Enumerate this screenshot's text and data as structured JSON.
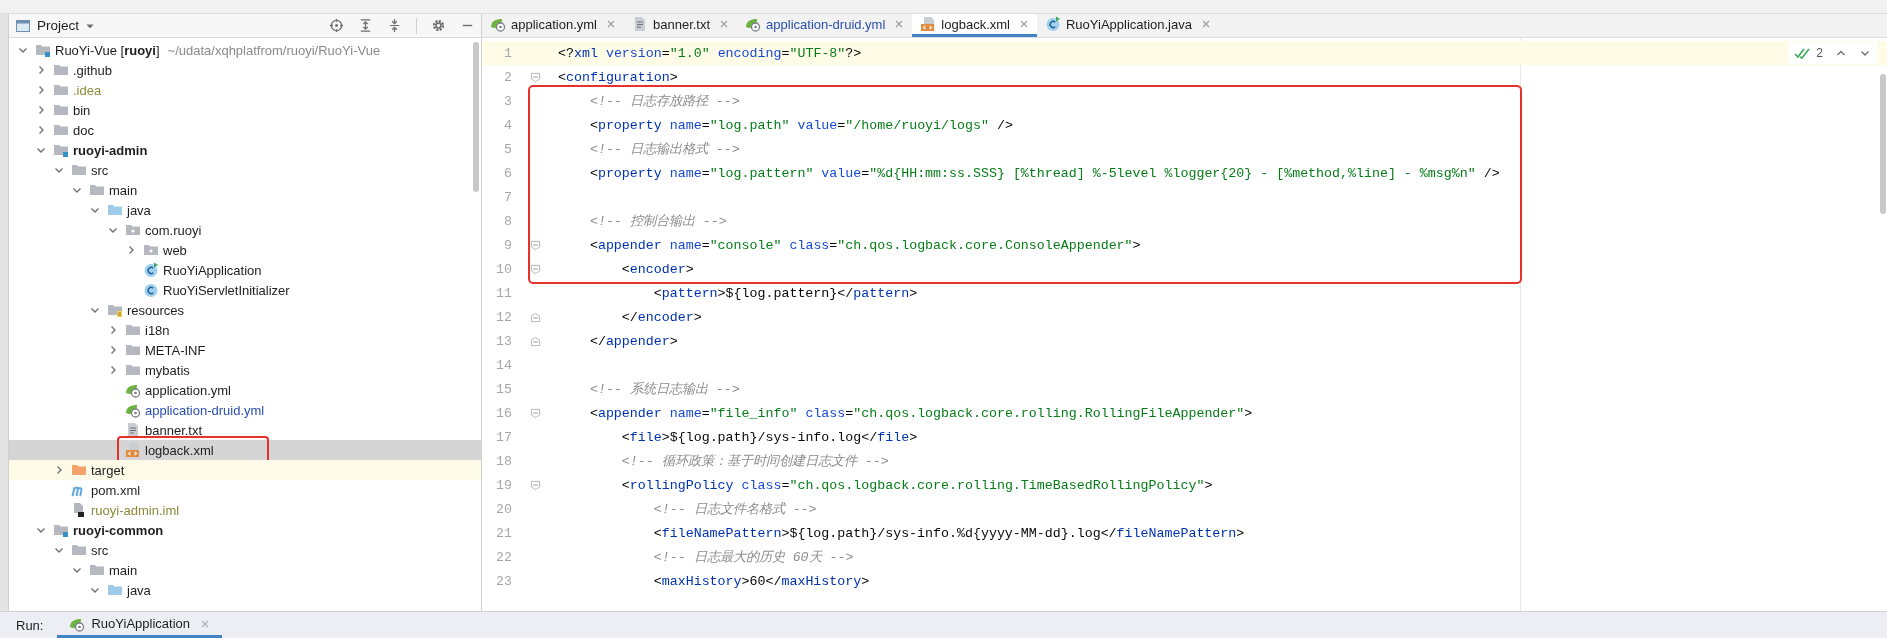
{
  "project_panel": {
    "title": "Project",
    "tree": [
      {
        "name": "RuoYi-Vue [**ruoyi**]",
        "path": "~/udata/xqhplatfrom/ruoyi/RuoYi-Vue",
        "kind": "module",
        "bold": false,
        "expanded": true,
        "selected": false,
        "boxed": false,
        "children": [
          {
            "name": ".github",
            "kind": "folder",
            "bold": false,
            "expanded": false,
            "selected": false,
            "boxed": false
          },
          {
            "name": ".idea",
            "kind": "folder",
            "color": "#8a8a3a",
            "bold": false,
            "expanded": false,
            "selected": false,
            "boxed": false
          },
          {
            "name": "bin",
            "kind": "folder",
            "bold": false,
            "expanded": false,
            "selected": false,
            "boxed": false
          },
          {
            "name": "doc",
            "kind": "folder",
            "bold": false,
            "expanded": false,
            "selected": false,
            "boxed": false
          },
          {
            "name": "ruoyi-admin",
            "kind": "module",
            "bold": true,
            "expanded": true,
            "selected": false,
            "boxed": false,
            "children": [
              {
                "name": "src",
                "kind": "folder",
                "bold": false,
                "expanded": true,
                "selected": false,
                "boxed": false,
                "children": [
                  {
                    "name": "main",
                    "kind": "folder",
                    "bold": false,
                    "expanded": true,
                    "selected": false,
                    "boxed": false,
                    "children": [
                      {
                        "name": "java",
                        "kind": "source-folder",
                        "bold": false,
                        "expanded": true,
                        "selected": false,
                        "boxed": false,
                        "children": [
                          {
                            "name": "com.ruoyi",
                            "kind": "package",
                            "bold": false,
                            "expanded": true,
                            "selected": false,
                            "boxed": false,
                            "children": [
                              {
                                "name": "web",
                                "kind": "package",
                                "bold": false,
                                "expanded": false,
                                "selected": false,
                                "boxed": false
                              },
                              {
                                "name": "RuoYiApplication",
                                "kind": "class-run",
                                "bold": false,
                                "selected": false,
                                "boxed": false
                              },
                              {
                                "name": "RuoYiServletInitializer",
                                "kind": "class",
                                "bold": false,
                                "selected": false,
                                "boxed": false
                              }
                            ]
                          }
                        ]
                      },
                      {
                        "name": "resources",
                        "kind": "resources",
                        "bold": false,
                        "expanded": true,
                        "selected": false,
                        "boxed": false,
                        "children": [
                          {
                            "name": "i18n",
                            "kind": "folder",
                            "bold": false,
                            "expanded": false,
                            "selected": false,
                            "boxed": false
                          },
                          {
                            "name": "META-INF",
                            "kind": "folder",
                            "bold": false,
                            "expanded": false,
                            "selected": false,
                            "boxed": false
                          },
                          {
                            "name": "mybatis",
                            "kind": "folder",
                            "bold": false,
                            "expanded": false,
                            "selected": false,
                            "boxed": false
                          },
                          {
                            "name": "application.yml",
                            "kind": "spring-yml",
                            "bold": false,
                            "selected": false,
                            "boxed": false
                          },
                          {
                            "name": "application-druid.yml",
                            "kind": "spring-yml",
                            "color": "#2a4fb0",
                            "bold": false,
                            "selected": false,
                            "boxed": false
                          },
                          {
                            "name": "banner.txt",
                            "kind": "text-file",
                            "bold": false,
                            "selected": false,
                            "boxed": false
                          },
                          {
                            "name": "logback.xml",
                            "kind": "xml-file",
                            "bold": false,
                            "selected": true,
                            "boxed": true
                          }
                        ]
                      }
                    ]
                  }
                ]
              },
              {
                "name": "target",
                "kind": "excluded-folder",
                "bold": false,
                "expanded": false,
                "selected": false,
                "boxed": false
              },
              {
                "name": "pom.xml",
                "kind": "maven",
                "bold": false,
                "selected": false,
                "boxed": false
              },
              {
                "name": "ruoyi-admin.iml",
                "kind": "iml",
                "color": "#8a8a3a",
                "bold": false,
                "selected": false,
                "boxed": false
              }
            ]
          },
          {
            "name": "ruoyi-common",
            "kind": "module",
            "bold": true,
            "expanded": true,
            "selected": false,
            "boxed": false,
            "children": [
              {
                "name": "src",
                "kind": "folder",
                "bold": false,
                "expanded": true,
                "selected": false,
                "boxed": false,
                "children": [
                  {
                    "name": "main",
                    "kind": "folder",
                    "bold": false,
                    "expanded": true,
                    "selected": false,
                    "boxed": false,
                    "children": [
                      {
                        "name": "java",
                        "kind": "source-folder",
                        "bold": false,
                        "expanded": true,
                        "selected": false,
                        "boxed": false
                      }
                    ]
                  }
                ]
              }
            ]
          }
        ]
      }
    ]
  },
  "editor_tabs": [
    {
      "label": "application.yml",
      "kind": "spring-yml",
      "selected": false
    },
    {
      "label": "banner.txt",
      "kind": "text-file",
      "selected": false
    },
    {
      "label": "application-druid.yml",
      "kind": "spring-yml",
      "color": "#2a4fb0",
      "selected": false
    },
    {
      "label": "logback.xml",
      "kind": "xml-file",
      "selected": true
    },
    {
      "label": "RuoYiApplication.java",
      "kind": "class-run",
      "selected": false
    }
  ],
  "editor": {
    "inspection_count": "2",
    "blocks": [
      {
        "boxed": false,
        "lines": [
          {
            "number": "1",
            "kind": "plain",
            "current": true,
            "tokens": [
              {
                "kind": "punct",
                "text": "<?"
              },
              {
                "kind": "tag",
                "text": "xml"
              },
              {
                "kind": "attr",
                "text": " version"
              },
              {
                "kind": "punct",
                "text": "="
              },
              {
                "kind": "value",
                "text": "\"1.0\""
              },
              {
                "kind": "attr",
                "text": " encoding"
              },
              {
                "kind": "punct",
                "text": "="
              },
              {
                "kind": "value",
                "text": "\"UTF-8\""
              },
              {
                "kind": "punct",
                "text": "?>"
              }
            ]
          },
          {
            "number": "2",
            "kind": "opening",
            "current": false,
            "tokens": [
              {
                "kind": "punct",
                "text": "<"
              },
              {
                "kind": "tag",
                "text": "configuration"
              },
              {
                "kind": "punct",
                "text": ">"
              }
            ]
          }
        ]
      },
      {
        "boxed": true,
        "lines": [
          {
            "number": "3",
            "kind": "plain",
            "current": false,
            "tokens": [
              {
                "kind": "comment",
                "text": "    <!-- 日志存放路径 -->"
              }
            ]
          },
          {
            "number": "4",
            "kind": "plain",
            "current": false,
            "tokens": [
              {
                "kind": "punct",
                "text": "    <"
              },
              {
                "kind": "tag",
                "text": "property"
              },
              {
                "kind": "attr",
                "text": " name"
              },
              {
                "kind": "punct",
                "text": "="
              },
              {
                "kind": "value",
                "text": "\"log.path\""
              },
              {
                "kind": "attr",
                "text": " value"
              },
              {
                "kind": "punct",
                "text": "="
              },
              {
                "kind": "value",
                "text": "\"/home/ruoyi/logs\""
              },
              {
                "kind": "punct",
                "text": " />"
              }
            ]
          },
          {
            "number": "5",
            "kind": "plain",
            "current": false,
            "tokens": [
              {
                "kind": "comment",
                "text": "    <!-- 日志输出格式 -->"
              }
            ]
          },
          {
            "number": "6",
            "kind": "plain",
            "current": false,
            "tokens": [
              {
                "kind": "punct",
                "text": "    <"
              },
              {
                "kind": "tag",
                "text": "property"
              },
              {
                "kind": "attr",
                "text": " name"
              },
              {
                "kind": "punct",
                "text": "="
              },
              {
                "kind": "value",
                "text": "\"log.pattern\""
              },
              {
                "kind": "attr",
                "text": " value"
              },
              {
                "kind": "punct",
                "text": "="
              },
              {
                "kind": "value",
                "text": "\"%d{HH:mm:ss.SSS} [%thread] %-5level %logger{20} - [%method,%line] - %msg%n\""
              },
              {
                "kind": "punct",
                "text": " />"
              }
            ]
          },
          {
            "number": "7",
            "kind": "plain",
            "current": false
          },
          {
            "number": "8",
            "kind": "plain",
            "current": false,
            "tokens": [
              {
                "kind": "comment",
                "text": "    <!-- 控制台输出 -->"
              }
            ]
          },
          {
            "number": "9",
            "kind": "opening",
            "current": false,
            "tokens": [
              {
                "kind": "punct",
                "text": "    <"
              },
              {
                "kind": "tag",
                "text": "appender"
              },
              {
                "kind": "attr",
                "text": " name"
              },
              {
                "kind": "punct",
                "text": "="
              },
              {
                "kind": "value",
                "text": "\"console\""
              },
              {
                "kind": "attr",
                "text": " class"
              },
              {
                "kind": "punct",
                "text": "="
              },
              {
                "kind": "value",
                "text": "\"ch.qos.logback.core.ConsoleAppender\""
              },
              {
                "kind": "punct",
                "text": ">"
              }
            ]
          },
          {
            "number": "10",
            "kind": "opening",
            "current": false,
            "tokens": [
              {
                "kind": "punct",
                "text": "        <"
              },
              {
                "kind": "tag",
                "text": "encoder"
              },
              {
                "kind": "punct",
                "text": ">"
              }
            ]
          }
        ]
      },
      {
        "boxed": false,
        "lines": [
          {
            "number": "11",
            "kind": "plain",
            "current": false,
            "tokens": [
              {
                "kind": "punct",
                "text": "            <"
              },
              {
                "kind": "tag",
                "text": "pattern"
              },
              {
                "kind": "punct",
                "text": ">"
              },
              {
                "kind": "text",
                "text": "${log.pattern}"
              },
              {
                "kind": "punct",
                "text": "</"
              },
              {
                "kind": "tag",
                "text": "pattern"
              },
              {
                "kind": "punct",
                "text": ">"
              }
            ]
          },
          {
            "number": "12",
            "kind": "closing",
            "current": false,
            "tokens": [
              {
                "kind": "punct",
                "text": "        </"
              },
              {
                "kind": "tag",
                "text": "encoder"
              },
              {
                "kind": "punct",
                "text": ">"
              }
            ]
          },
          {
            "number": "13",
            "kind": "closing",
            "current": false,
            "tokens": [
              {
                "kind": "punct",
                "text": "    </"
              },
              {
                "kind": "tag",
                "text": "appender"
              },
              {
                "kind": "punct",
                "text": ">"
              }
            ]
          },
          {
            "number": "14",
            "kind": "plain",
            "current": false
          },
          {
            "number": "15",
            "kind": "plain",
            "current": false,
            "tokens": [
              {
                "kind": "comment",
                "text": "    <!-- 系统日志输出 -->"
              }
            ]
          },
          {
            "number": "16",
            "kind": "opening",
            "current": false,
            "tokens": [
              {
                "kind": "punct",
                "text": "    <"
              },
              {
                "kind": "tag",
                "text": "appender"
              },
              {
                "kind": "attr",
                "text": " name"
              },
              {
                "kind": "punct",
                "text": "="
              },
              {
                "kind": "value",
                "text": "\"file_info\""
              },
              {
                "kind": "attr",
                "text": " class"
              },
              {
                "kind": "punct",
                "text": "="
              },
              {
                "kind": "value",
                "text": "\"ch.qos.logback.core.rolling.RollingFileAppender\""
              },
              {
                "kind": "punct",
                "text": ">"
              }
            ]
          },
          {
            "number": "17",
            "kind": "plain",
            "current": false,
            "tokens": [
              {
                "kind": "punct",
                "text": "        <"
              },
              {
                "kind": "tag",
                "text": "file"
              },
              {
                "kind": "punct",
                "text": ">"
              },
              {
                "kind": "text",
                "text": "${log.path}/sys-info.log"
              },
              {
                "kind": "punct",
                "text": "</"
              },
              {
                "kind": "tag",
                "text": "file"
              },
              {
                "kind": "punct",
                "text": ">"
              }
            ]
          },
          {
            "number": "18",
            "kind": "plain",
            "current": false,
            "tokens": [
              {
                "kind": "comment",
                "text": "        <!-- 循环政策：基于时间创建日志文件 -->"
              }
            ]
          },
          {
            "number": "19",
            "kind": "opening",
            "current": false,
            "tokens": [
              {
                "kind": "punct",
                "text": "        <"
              },
              {
                "kind": "tag",
                "text": "rollingPolicy"
              },
              {
                "kind": "attr",
                "text": " class"
              },
              {
                "kind": "punct",
                "text": "="
              },
              {
                "kind": "value",
                "text": "\"ch.qos.logback.core.rolling.TimeBasedRollingPolicy\""
              },
              {
                "kind": "punct",
                "text": ">"
              }
            ]
          },
          {
            "number": "20",
            "kind": "plain",
            "current": false,
            "tokens": [
              {
                "kind": "comment",
                "text": "            <!-- 日志文件名格式 -->"
              }
            ]
          },
          {
            "number": "21",
            "kind": "plain",
            "current": false,
            "tokens": [
              {
                "kind": "punct",
                "text": "            <"
              },
              {
                "kind": "tag",
                "text": "fileNamePattern"
              },
              {
                "kind": "punct",
                "text": ">"
              },
              {
                "kind": "text",
                "text": "${log.path}/sys-info.%d{yyyy-MM-dd}.log"
              },
              {
                "kind": "punct",
                "text": "</"
              },
              {
                "kind": "tag",
                "text": "fileNamePattern"
              },
              {
                "kind": "punct",
                "text": ">"
              }
            ]
          },
          {
            "number": "22",
            "kind": "plain",
            "current": false,
            "tokens": [
              {
                "kind": "comment",
                "text": "            <!-- 日志最大的历史 60天 -->"
              }
            ]
          },
          {
            "number": "23",
            "kind": "plain",
            "current": false,
            "tokens": [
              {
                "kind": "punct",
                "text": "            <"
              },
              {
                "kind": "tag",
                "text": "maxHistory"
              },
              {
                "kind": "punct",
                "text": ">"
              },
              {
                "kind": "text",
                "text": "60"
              },
              {
                "kind": "punct",
                "text": "</"
              },
              {
                "kind": "tag",
                "text": "maxHistory"
              },
              {
                "kind": "punct",
                "text": ">"
              }
            ]
          }
        ]
      }
    ]
  },
  "run_bar": {
    "label": "Run:",
    "tabs": [
      {
        "label": "RuoYiApplication",
        "kind": "spring-yml",
        "selected": true
      }
    ]
  }
}
